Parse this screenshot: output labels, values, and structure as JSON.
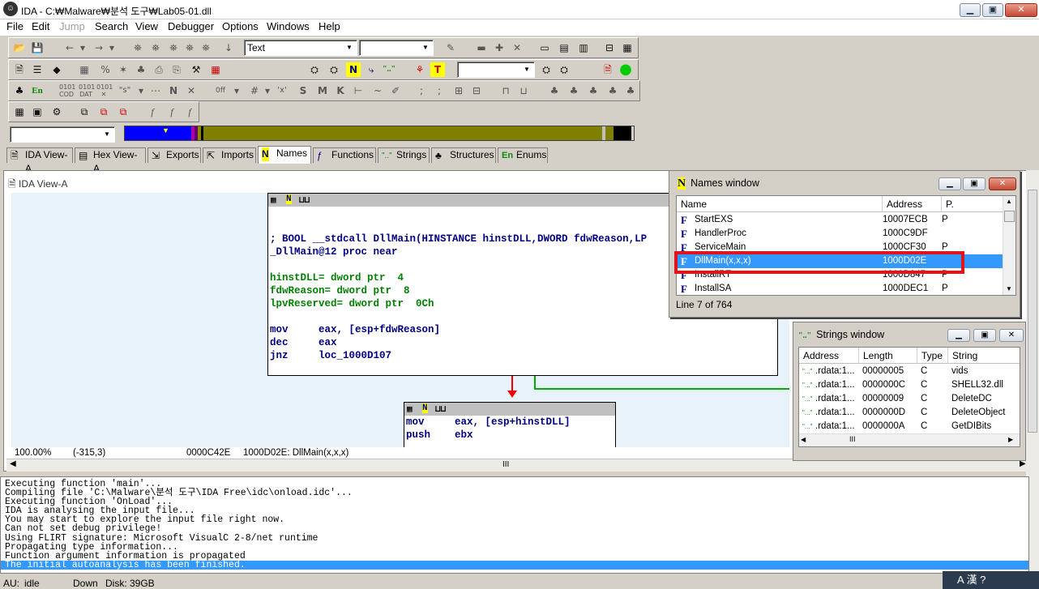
{
  "window": {
    "title": "IDA - C:₩Malware₩분석 도구₩Lab05-01.dll",
    "app_icon": "ida-icon",
    "controls": {
      "minimize": "▁",
      "maximize": "▣",
      "close": "✕"
    }
  },
  "menubar": {
    "items": [
      "File",
      "Edit",
      "Jump",
      "Search",
      "View",
      "Debugger",
      "Options",
      "Windows",
      "Help"
    ],
    "disabled": [
      "Jump"
    ]
  },
  "toolbar": {
    "text_combo": "Text",
    "empty_combo": ""
  },
  "tabs": [
    {
      "label": "IDA View-A",
      "icon": "🗎"
    },
    {
      "label": "Hex View-A",
      "icon": "▤"
    },
    {
      "label": "Exports",
      "icon": "⇲"
    },
    {
      "label": "Imports",
      "icon": "⇱"
    },
    {
      "label": "Names",
      "icon": "N"
    },
    {
      "label": "Functions",
      "icon": "ƒ"
    },
    {
      "label": "Strings",
      "icon": "\"..\""
    },
    {
      "label": "Structures",
      "icon": "♣"
    },
    {
      "label": "Enums",
      "icon": "En"
    }
  ],
  "ida_view": {
    "header": "IDA View-A",
    "block1": {
      "lines": [
        "",
        "",
        "; BOOL __stdcall DllMain(HINSTANCE hinstDLL,DWORD fdwReason,LP",
        "_DllMain@12 proc near",
        "",
        "hinstDLL= dword ptr  4",
        "fdwReason= dword ptr  8",
        "lpvReserved= dword ptr  0Ch",
        "",
        "mov     eax, [esp+fdwReason]",
        "dec     eax",
        "jnz     loc_1000D107"
      ]
    },
    "block2": {
      "lines": [
        "mov     eax, [esp+hinstDLL]",
        "push    ebx"
      ]
    },
    "status": {
      "zoom": "100.00%",
      "coords": "(-315,3)",
      "offset": "0000C42E",
      "location": "1000D02E: DllMain(x,x,x)"
    },
    "scroll_label": "III"
  },
  "names_window": {
    "title": "Names window",
    "columns": [
      "Name",
      "Address",
      "P."
    ],
    "rows": [
      {
        "name": "StartEXS",
        "address": "10007ECB",
        "p": "P"
      },
      {
        "name": "HandlerProc",
        "address": "1000C9DF",
        "p": ""
      },
      {
        "name": "ServiceMain",
        "address": "1000CF30",
        "p": "P"
      },
      {
        "name": "DllMain(x,x,x)",
        "address": "1000D02E",
        "p": ""
      },
      {
        "name": "InstallRT",
        "address": "1000D847",
        "p": "P"
      },
      {
        "name": "InstallSA",
        "address": "1000DEC1",
        "p": "P"
      }
    ],
    "selected_index": 3,
    "footer": "Line 7 of 764"
  },
  "strings_window": {
    "title": "Strings window",
    "columns": [
      "Address",
      "Length",
      "Type",
      "String"
    ],
    "rows": [
      {
        "address": ".rdata:1...",
        "length": "00000005",
        "type": "C",
        "string": "vids"
      },
      {
        "address": ".rdata:1...",
        "length": "0000000C",
        "type": "C",
        "string": "SHELL32.dll"
      },
      {
        "address": ".rdata:1...",
        "length": "00000009",
        "type": "C",
        "string": "DeleteDC"
      },
      {
        "address": ".rdata:1...",
        "length": "0000000D",
        "type": "C",
        "string": "DeleteObject"
      },
      {
        "address": ".rdata:1...",
        "length": "0000000A",
        "type": "C",
        "string": "GetDIBits"
      }
    ],
    "scroll_label": "III"
  },
  "output": {
    "lines": [
      "Executing function 'main'...",
      "Compiling file 'C:\\Malware\\분석 도구\\IDA Free\\idc\\onload.idc'...",
      "Executing function 'OnLoad'...",
      "IDA is analysing the input file...",
      "You may start to explore the input file right now.",
      "Can not set debug privilege!",
      "Using FLIRT signature: Microsoft VisualC 2-8/net runtime",
      "Propagating type information...",
      "Function argument information is propagated",
      "The initial autoanalysis has been finished."
    ],
    "selected_index": 9
  },
  "statusbar": {
    "au": "AU:",
    "state": "idle",
    "direction": "Down",
    "disk": "Disk: 39GB"
  },
  "tray": {
    "text": "A 漢 ?"
  }
}
